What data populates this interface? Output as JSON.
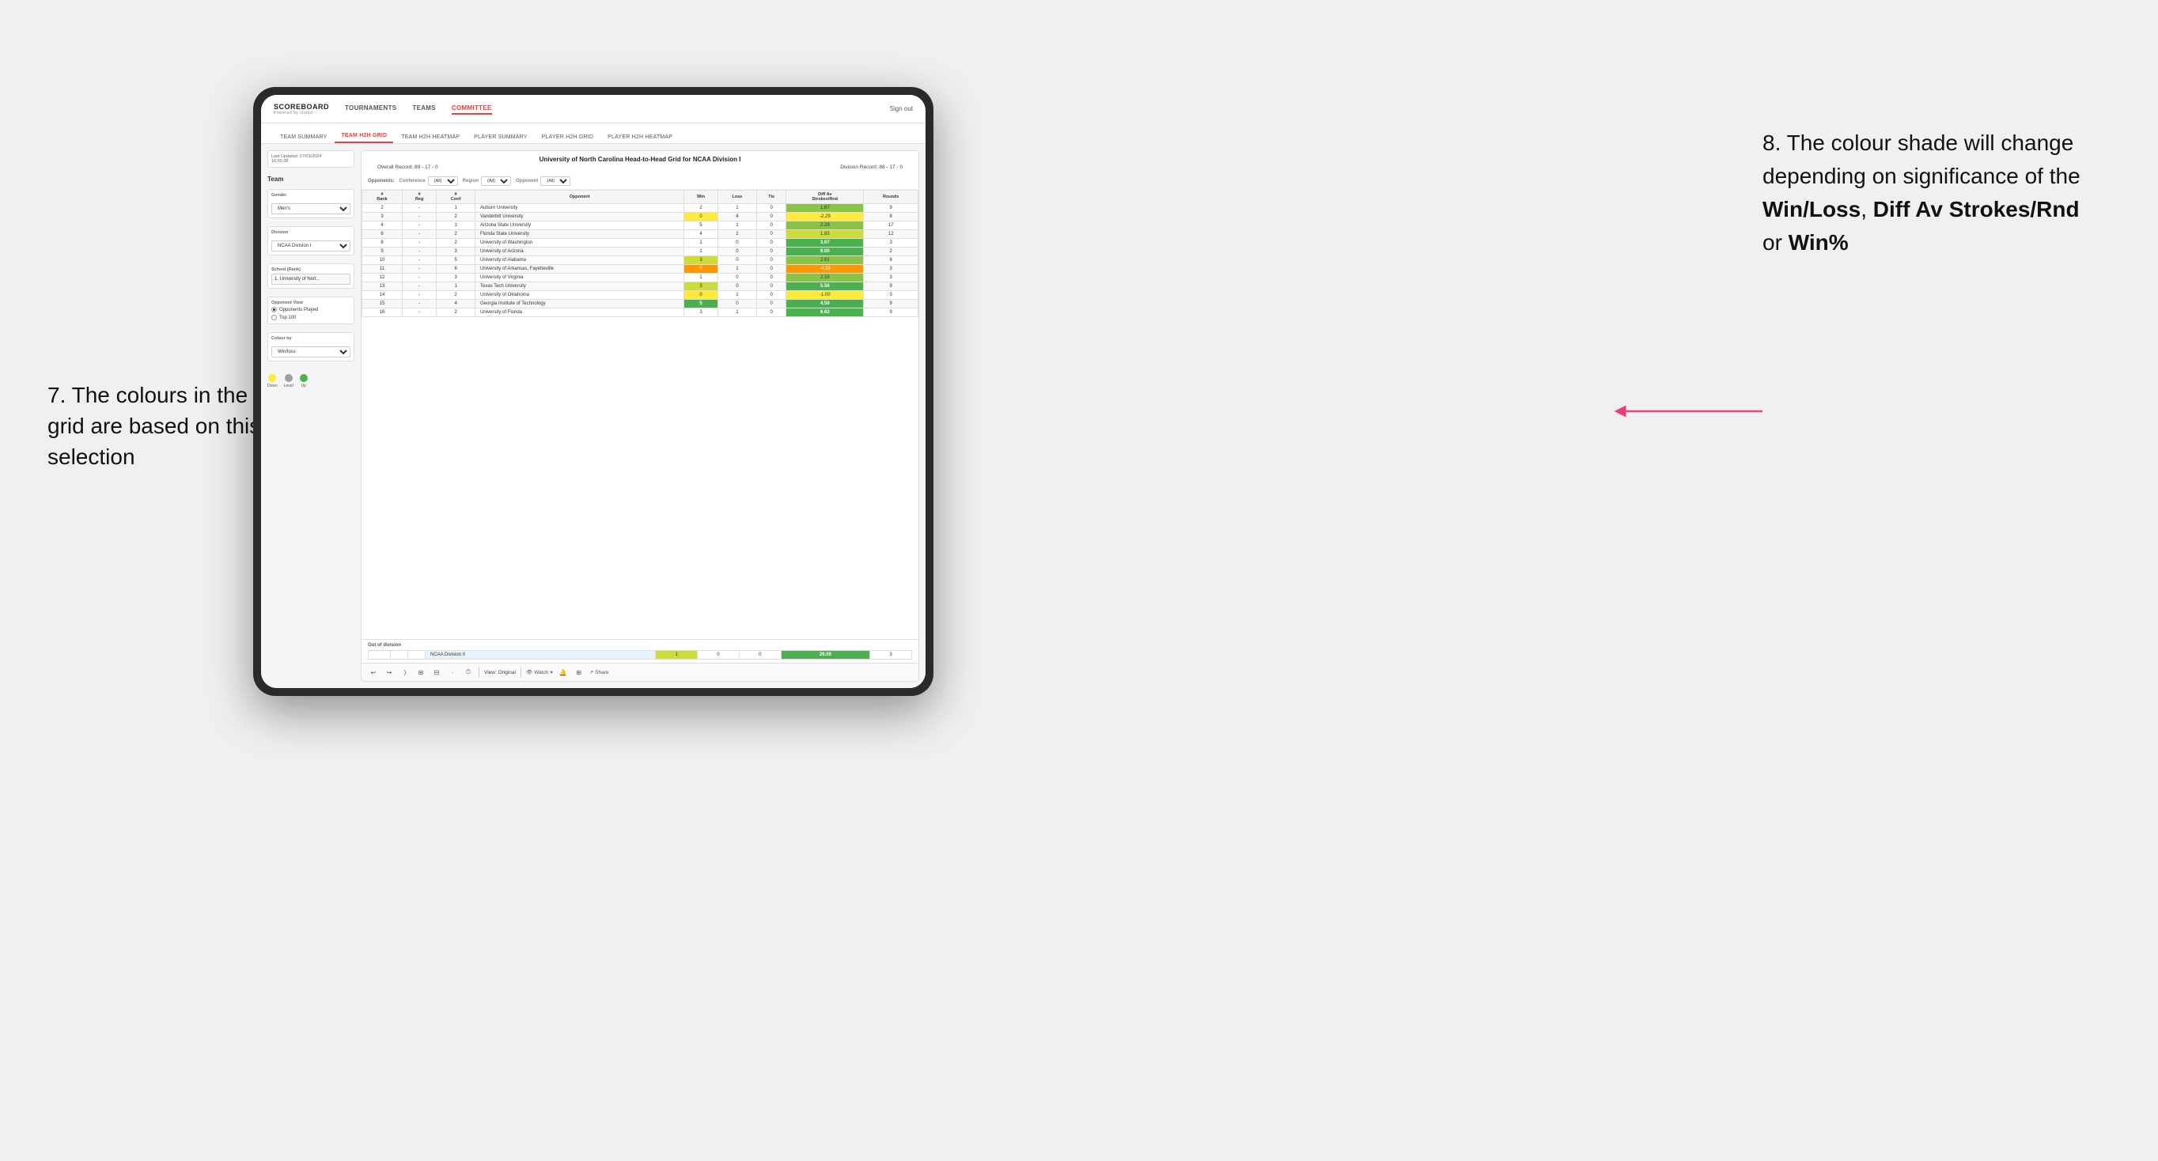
{
  "annotations": {
    "left_title": "7. The colours in the grid are based on this selection",
    "right_title": "8. The colour shade will change depending on significance of the",
    "right_bold1": "Win/Loss",
    "right_bold2": "Diff Av Strokes/Rnd",
    "right_bold3": "Win%"
  },
  "app": {
    "logo": "SCOREBOARD",
    "logo_sub": "Powered by clippd",
    "sign_out": "Sign out",
    "nav": [
      "TOURNAMENTS",
      "TEAMS",
      "COMMITTEE"
    ],
    "sub_nav": [
      "TEAM SUMMARY",
      "TEAM H2H GRID",
      "TEAM H2H HEATMAP",
      "PLAYER SUMMARY",
      "PLAYER H2H GRID",
      "PLAYER H2H HEATMAP"
    ]
  },
  "left_panel": {
    "last_updated_label": "Last Updated: 27/03/2024",
    "last_updated_time": "16:55:38",
    "team_label": "Team",
    "gender_label": "Gender",
    "gender_value": "Men's",
    "division_label": "Division",
    "division_value": "NCAA Division I",
    "school_label": "School (Rank)",
    "school_value": "1. University of Nort...",
    "opponent_view_label": "Opponent View",
    "radio1": "Opponents Played",
    "radio2": "Top 100",
    "colour_by_label": "Colour by",
    "colour_by_value": "Win/loss",
    "legend": {
      "down_label": "Down",
      "level_label": "Level",
      "up_label": "Up",
      "down_color": "#ffeb3b",
      "level_color": "#9e9e9e",
      "up_color": "#4caf50"
    }
  },
  "grid": {
    "title": "University of North Carolina Head-to-Head Grid for NCAA Division I",
    "overall_record": "Overall Record: 89 - 17 - 0",
    "division_record": "Division Record: 88 - 17 - 0",
    "filters": {
      "opponents_label": "Opponents:",
      "conference_label": "Conference",
      "conference_value": "(All)",
      "region_label": "Region",
      "region_value": "(All)",
      "opponent_label": "Opponent",
      "opponent_value": "(All)"
    },
    "columns": [
      "#\nRank",
      "#\nReg",
      "#\nConf",
      "Opponent",
      "Win",
      "Loss",
      "Tie",
      "Diff Av\nStrokes/Rnd",
      "Rounds"
    ],
    "rows": [
      {
        "rank": "2",
        "reg": "-",
        "conf": "1",
        "opponent": "Auburn University",
        "win": "2",
        "loss": "1",
        "tie": "0",
        "diff": "1.67",
        "rounds": "9",
        "win_color": "cell-neutral",
        "loss_color": "cell-neutral",
        "diff_color": "cell-green-mid"
      },
      {
        "rank": "3",
        "reg": "-",
        "conf": "2",
        "opponent": "Vanderbilt University",
        "win": "0",
        "loss": "4",
        "tie": "0",
        "diff": "-2.29",
        "rounds": "8",
        "win_color": "cell-yellow",
        "loss_color": "cell-neutral",
        "diff_color": "cell-yellow"
      },
      {
        "rank": "4",
        "reg": "-",
        "conf": "1",
        "opponent": "Arizona State University",
        "win": "5",
        "loss": "1",
        "tie": "0",
        "diff": "2.28",
        "rounds": "17",
        "win_color": "cell-neutral",
        "loss_color": "cell-neutral",
        "diff_color": "cell-green-mid"
      },
      {
        "rank": "6",
        "reg": "-",
        "conf": "2",
        "opponent": "Florida State University",
        "win": "4",
        "loss": "2",
        "tie": "0",
        "diff": "1.83",
        "rounds": "12",
        "win_color": "cell-neutral",
        "loss_color": "cell-neutral",
        "diff_color": "cell-green-light"
      },
      {
        "rank": "8",
        "reg": "-",
        "conf": "2",
        "opponent": "University of Washington",
        "win": "1",
        "loss": "0",
        "tie": "0",
        "diff": "3.67",
        "rounds": "3",
        "win_color": "cell-neutral",
        "loss_color": "cell-neutral",
        "diff_color": "cell-green-dark"
      },
      {
        "rank": "9",
        "reg": "-",
        "conf": "3",
        "opponent": "University of Arizona",
        "win": "1",
        "loss": "0",
        "tie": "0",
        "diff": "9.00",
        "rounds": "2",
        "win_color": "cell-neutral",
        "loss_color": "cell-neutral",
        "diff_color": "cell-green-dark"
      },
      {
        "rank": "10",
        "reg": "-",
        "conf": "5",
        "opponent": "University of Alabama",
        "win": "3",
        "loss": "0",
        "tie": "0",
        "diff": "2.61",
        "rounds": "8",
        "win_color": "cell-green-light",
        "loss_color": "cell-neutral",
        "diff_color": "cell-green-mid"
      },
      {
        "rank": "11",
        "reg": "-",
        "conf": "6",
        "opponent": "University of Arkansas, Fayetteville",
        "win": "0",
        "loss": "1",
        "tie": "0",
        "diff": "-4.33",
        "rounds": "3",
        "win_color": "cell-orange",
        "loss_color": "cell-neutral",
        "diff_color": "cell-orange"
      },
      {
        "rank": "12",
        "reg": "-",
        "conf": "3",
        "opponent": "University of Virginia",
        "win": "1",
        "loss": "0",
        "tie": "0",
        "diff": "2.33",
        "rounds": "3",
        "win_color": "cell-neutral",
        "loss_color": "cell-neutral",
        "diff_color": "cell-green-mid"
      },
      {
        "rank": "13",
        "reg": "-",
        "conf": "1",
        "opponent": "Texas Tech University",
        "win": "3",
        "loss": "0",
        "tie": "0",
        "diff": "5.56",
        "rounds": "9",
        "win_color": "cell-green-light",
        "loss_color": "cell-neutral",
        "diff_color": "cell-green-dark"
      },
      {
        "rank": "14",
        "reg": "-",
        "conf": "2",
        "opponent": "University of Oklahoma",
        "win": "0",
        "loss": "1",
        "tie": "0",
        "diff": "-1.00",
        "rounds": "3",
        "win_color": "cell-yellow",
        "loss_color": "cell-neutral",
        "diff_color": "cell-yellow"
      },
      {
        "rank": "15",
        "reg": "-",
        "conf": "4",
        "opponent": "Georgia Institute of Technology",
        "win": "5",
        "loss": "0",
        "tie": "0",
        "diff": "4.50",
        "rounds": "9",
        "win_color": "cell-green-dark",
        "loss_color": "cell-neutral",
        "diff_color": "cell-green-dark"
      },
      {
        "rank": "16",
        "reg": "-",
        "conf": "2",
        "opponent": "University of Florida",
        "win": "3",
        "loss": "1",
        "tie": "0",
        "diff": "6.62",
        "rounds": "9",
        "win_color": "cell-neutral",
        "loss_color": "cell-neutral",
        "diff_color": "cell-green-dark"
      }
    ],
    "out_of_division_label": "Out of division",
    "out_of_division_row": {
      "name": "NCAA Division II",
      "win": "1",
      "loss": "0",
      "tie": "0",
      "diff": "26.00",
      "rounds": "3",
      "win_color": "cell-green-light",
      "diff_color": "cell-green-dark"
    }
  },
  "toolbar": {
    "view_label": "View: Original",
    "watch_label": "Watch",
    "share_label": "Share"
  }
}
